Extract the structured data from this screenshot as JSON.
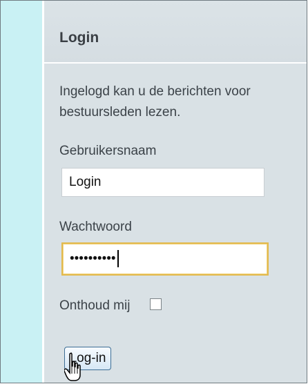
{
  "login": {
    "title": "Login",
    "intro": "Ingelogd kan u de berichten voor bestuursleden lezen.",
    "username_label": "Gebruikersnaam",
    "username_value": "Login",
    "password_label": "Wachtwoord",
    "password_mask": "••••••••••",
    "remember_label": "Onthoud mij",
    "button_label": "Log-in"
  },
  "icons": {
    "cursor": "hand-pointer-icon"
  }
}
